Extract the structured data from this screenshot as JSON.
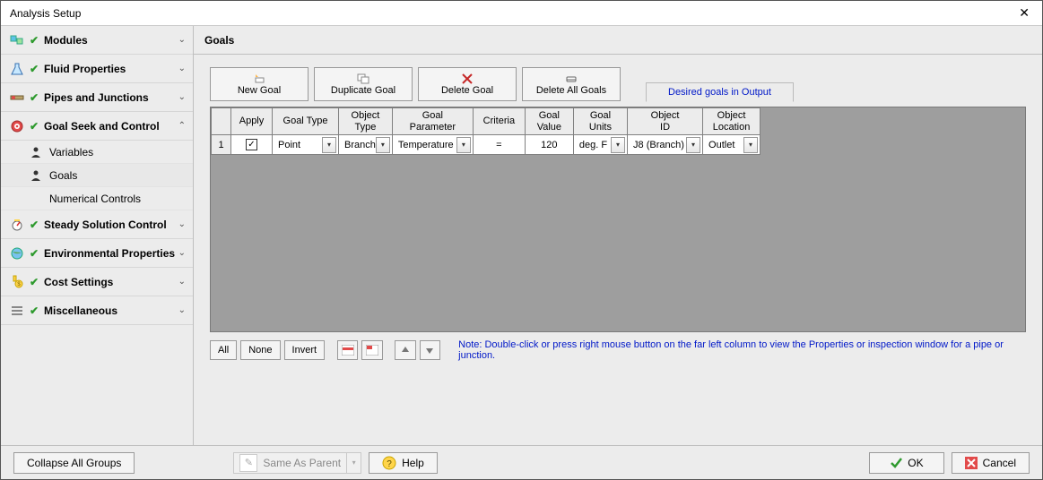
{
  "window": {
    "title": "Analysis Setup"
  },
  "sidebar": {
    "groups": [
      {
        "label": "Modules",
        "expanded": false,
        "check": true
      },
      {
        "label": "Fluid Properties",
        "expanded": false,
        "check": true
      },
      {
        "label": "Pipes and Junctions",
        "expanded": false,
        "check": true
      },
      {
        "label": "Goal Seek and Control",
        "expanded": true,
        "check": true,
        "children": [
          {
            "label": "Variables"
          },
          {
            "label": "Goals",
            "active": true
          },
          {
            "label": "Numerical Controls"
          }
        ]
      },
      {
        "label": "Steady Solution Control",
        "expanded": false,
        "check": true
      },
      {
        "label": "Environmental Properties",
        "expanded": false,
        "check": true
      },
      {
        "label": "Cost Settings",
        "expanded": false,
        "check": true
      },
      {
        "label": "Miscellaneous",
        "expanded": false,
        "check": true
      }
    ]
  },
  "content": {
    "header": "Goals",
    "toolbar": {
      "new_goal": "New Goal",
      "duplicate_goal": "Duplicate Goal",
      "delete_goal": "Delete Goal",
      "delete_all_goals": "Delete All Goals",
      "desired_tab": "Desired goals in Output"
    },
    "grid": {
      "columns": [
        "",
        "Apply",
        "Goal Type",
        "Object Type",
        "Goal Parameter",
        "Criteria",
        "Goal Value",
        "Goal Units",
        "Object ID",
        "Object Location"
      ],
      "rows": [
        {
          "n": "1",
          "apply": true,
          "goal_type": "Point",
          "object_type": "Branch",
          "goal_parameter": "Temperature",
          "criteria": "=",
          "goal_value": "120",
          "goal_units": "deg. F",
          "object_id": "J8 (Branch)",
          "object_location": "Outlet"
        }
      ]
    },
    "below": {
      "all": "All",
      "none": "None",
      "invert": "Invert",
      "note": "Note: Double-click or press right mouse button on the far left column to view the Properties or inspection window for a pipe or junction."
    }
  },
  "footer": {
    "collapse": "Collapse All Groups",
    "same_as_parent": "Same As Parent",
    "help": "Help",
    "ok": "OK",
    "cancel": "Cancel"
  }
}
